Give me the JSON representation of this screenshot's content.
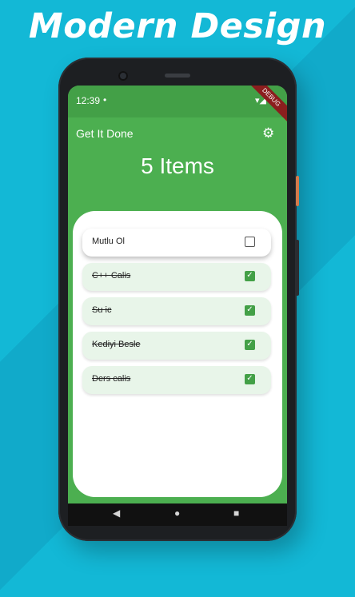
{
  "headline": "Modern Design",
  "status": {
    "time": "12:39",
    "dot": "•",
    "signal": "▾◢",
    "debug": "DEBUG"
  },
  "appbar": {
    "title": "Get It Done",
    "settings_icon": "gear-icon"
  },
  "summary": {
    "count_text": "5 Items"
  },
  "tasks": [
    {
      "label": "Mutlu Ol",
      "done": false
    },
    {
      "label": "C++ Calis",
      "done": true
    },
    {
      "label": "Su ic",
      "done": true
    },
    {
      "label": "Kediyi Besle",
      "done": true
    },
    {
      "label": "Ders calis",
      "done": true
    }
  ],
  "fab": {
    "icon": "+"
  },
  "nav": {
    "back": "◀",
    "home": "●",
    "recents": "■"
  },
  "colors": {
    "primary": "#4caf50",
    "accent_bg": "#13b8d6",
    "done_item_bg": "#e8f5e9"
  }
}
